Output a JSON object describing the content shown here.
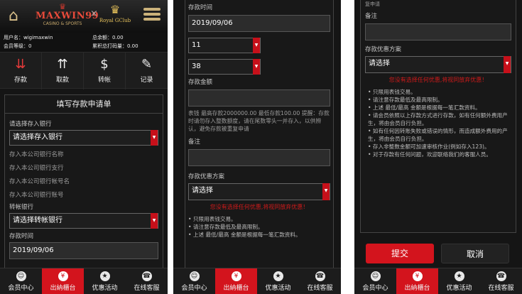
{
  "brand": {
    "primary": "MAXWIN99",
    "tagline": "CASINO & SPORTS",
    "partner": "Royal GClub",
    "separator": "×"
  },
  "user": {
    "username_label": "用户名：wigimaxwin",
    "level_label": "会员等级：0",
    "total_label": "总余额：0.00",
    "points_label": "累积总打码量：0.00"
  },
  "actions": [
    {
      "label": "存款",
      "icon": "deposit-icon"
    },
    {
      "label": "取款",
      "icon": "withdraw-icon"
    },
    {
      "label": "转帐",
      "icon": "transfer-icon"
    },
    {
      "label": "记录",
      "icon": "record-icon"
    }
  ],
  "form": {
    "title": "填写存款申请单",
    "bank_label": "请选择存入银行",
    "bank_value": "请选择存入银行",
    "company_bank_name": "存入本公司银行名称",
    "company_bank_branch": "存入本公司银行支行",
    "company_account_name": "存入本公司银行帐号名",
    "company_account_no": "存入本公司银行账号",
    "transfer_bank_label": "转帐银行",
    "transfer_bank_value": "请选择转帐银行",
    "time_label": "存款时间",
    "date_value": "2019/09/06",
    "hour_value": "11",
    "minute_value": "38",
    "amount_label": "存款金额",
    "amount_note": "表钱 最高存款2000000.00 最低存款100.00 提醒：存款时请勿存入整数额度，请在尾数零头一并存入，以供辨认，避免存款被重复申请",
    "remark_label": "备注",
    "promo_label": "存款优惠方案",
    "promo_value": "请选择",
    "promo_warning": "您没有选择任何优惠,将视同放弃优惠！",
    "top_cut": "复申请"
  },
  "rules": [
    "只限用表钱交易。",
    "请注意存款最低及最高限制。",
    "上述 最低/最高 金额是根据每一笔汇款资料。",
    "请会员依照以上存款方式进行存款，如有任何额外费用产生，将由会员自行负担。",
    "如有任何因转账失败或错误的情形，而造成额外费用的产生，将由会员自行负担。",
    "存入非整数金额可加速审核作业(例如存入123)。",
    "对于存款有任何问题，欢迎联络我们的客服人员。"
  ],
  "buttons": {
    "submit": "提交",
    "cancel": "取消"
  },
  "nav": [
    {
      "label": "会员中心",
      "icon": "member-icon"
    },
    {
      "label": "出納櫃台",
      "icon": "cashier-icon"
    },
    {
      "label": "优惠活动",
      "icon": "promo-icon"
    },
    {
      "label": "在线客服",
      "icon": "support-icon"
    }
  ],
  "colors": {
    "accent": "#d3141d",
    "bg": "#151515",
    "gold": "#cbb27a",
    "warning": "#d01a1a"
  }
}
